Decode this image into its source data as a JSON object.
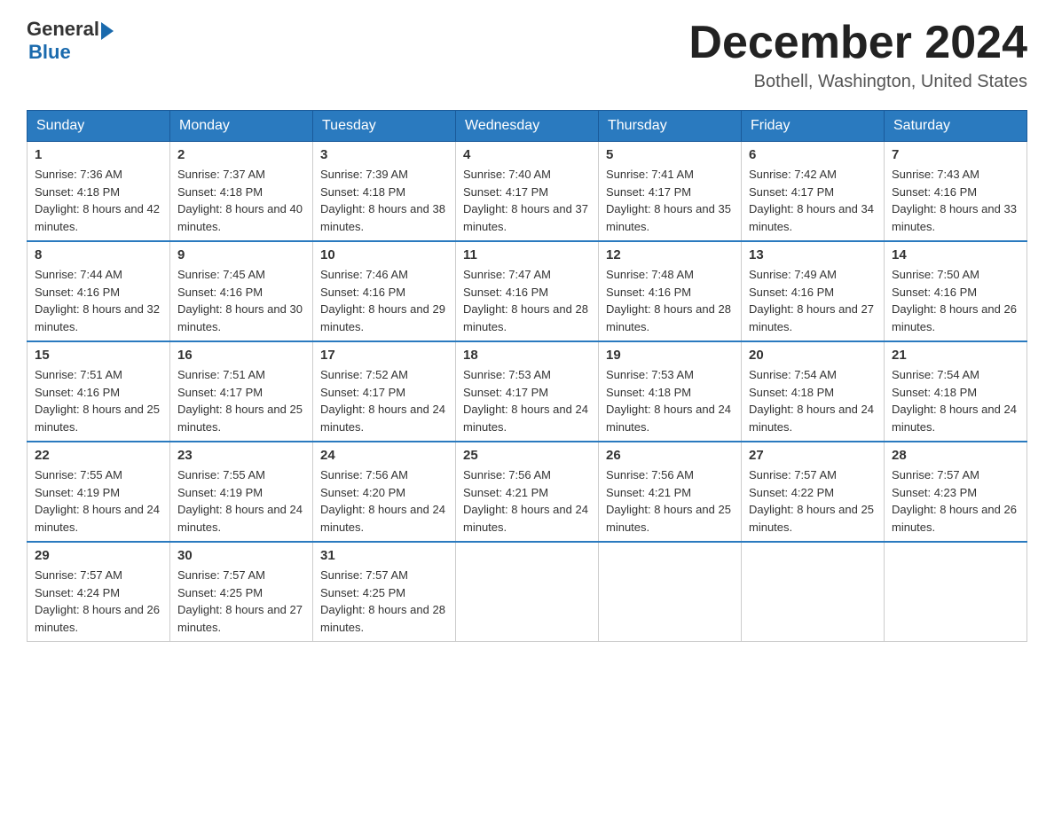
{
  "header": {
    "logo_general": "General",
    "logo_blue": "Blue",
    "month_year": "December 2024",
    "location": "Bothell, Washington, United States"
  },
  "days_of_week": [
    "Sunday",
    "Monday",
    "Tuesday",
    "Wednesday",
    "Thursday",
    "Friday",
    "Saturday"
  ],
  "weeks": [
    [
      {
        "day": "1",
        "sunrise": "7:36 AM",
        "sunset": "4:18 PM",
        "daylight": "8 hours and 42 minutes."
      },
      {
        "day": "2",
        "sunrise": "7:37 AM",
        "sunset": "4:18 PM",
        "daylight": "8 hours and 40 minutes."
      },
      {
        "day": "3",
        "sunrise": "7:39 AM",
        "sunset": "4:18 PM",
        "daylight": "8 hours and 38 minutes."
      },
      {
        "day": "4",
        "sunrise": "7:40 AM",
        "sunset": "4:17 PM",
        "daylight": "8 hours and 37 minutes."
      },
      {
        "day": "5",
        "sunrise": "7:41 AM",
        "sunset": "4:17 PM",
        "daylight": "8 hours and 35 minutes."
      },
      {
        "day": "6",
        "sunrise": "7:42 AM",
        "sunset": "4:17 PM",
        "daylight": "8 hours and 34 minutes."
      },
      {
        "day": "7",
        "sunrise": "7:43 AM",
        "sunset": "4:16 PM",
        "daylight": "8 hours and 33 minutes."
      }
    ],
    [
      {
        "day": "8",
        "sunrise": "7:44 AM",
        "sunset": "4:16 PM",
        "daylight": "8 hours and 32 minutes."
      },
      {
        "day": "9",
        "sunrise": "7:45 AM",
        "sunset": "4:16 PM",
        "daylight": "8 hours and 30 minutes."
      },
      {
        "day": "10",
        "sunrise": "7:46 AM",
        "sunset": "4:16 PM",
        "daylight": "8 hours and 29 minutes."
      },
      {
        "day": "11",
        "sunrise": "7:47 AM",
        "sunset": "4:16 PM",
        "daylight": "8 hours and 28 minutes."
      },
      {
        "day": "12",
        "sunrise": "7:48 AM",
        "sunset": "4:16 PM",
        "daylight": "8 hours and 28 minutes."
      },
      {
        "day": "13",
        "sunrise": "7:49 AM",
        "sunset": "4:16 PM",
        "daylight": "8 hours and 27 minutes."
      },
      {
        "day": "14",
        "sunrise": "7:50 AM",
        "sunset": "4:16 PM",
        "daylight": "8 hours and 26 minutes."
      }
    ],
    [
      {
        "day": "15",
        "sunrise": "7:51 AM",
        "sunset": "4:16 PM",
        "daylight": "8 hours and 25 minutes."
      },
      {
        "day": "16",
        "sunrise": "7:51 AM",
        "sunset": "4:17 PM",
        "daylight": "8 hours and 25 minutes."
      },
      {
        "day": "17",
        "sunrise": "7:52 AM",
        "sunset": "4:17 PM",
        "daylight": "8 hours and 24 minutes."
      },
      {
        "day": "18",
        "sunrise": "7:53 AM",
        "sunset": "4:17 PM",
        "daylight": "8 hours and 24 minutes."
      },
      {
        "day": "19",
        "sunrise": "7:53 AM",
        "sunset": "4:18 PM",
        "daylight": "8 hours and 24 minutes."
      },
      {
        "day": "20",
        "sunrise": "7:54 AM",
        "sunset": "4:18 PM",
        "daylight": "8 hours and 24 minutes."
      },
      {
        "day": "21",
        "sunrise": "7:54 AM",
        "sunset": "4:18 PM",
        "daylight": "8 hours and 24 minutes."
      }
    ],
    [
      {
        "day": "22",
        "sunrise": "7:55 AM",
        "sunset": "4:19 PM",
        "daylight": "8 hours and 24 minutes."
      },
      {
        "day": "23",
        "sunrise": "7:55 AM",
        "sunset": "4:19 PM",
        "daylight": "8 hours and 24 minutes."
      },
      {
        "day": "24",
        "sunrise": "7:56 AM",
        "sunset": "4:20 PM",
        "daylight": "8 hours and 24 minutes."
      },
      {
        "day": "25",
        "sunrise": "7:56 AM",
        "sunset": "4:21 PM",
        "daylight": "8 hours and 24 minutes."
      },
      {
        "day": "26",
        "sunrise": "7:56 AM",
        "sunset": "4:21 PM",
        "daylight": "8 hours and 25 minutes."
      },
      {
        "day": "27",
        "sunrise": "7:57 AM",
        "sunset": "4:22 PM",
        "daylight": "8 hours and 25 minutes."
      },
      {
        "day": "28",
        "sunrise": "7:57 AM",
        "sunset": "4:23 PM",
        "daylight": "8 hours and 26 minutes."
      }
    ],
    [
      {
        "day": "29",
        "sunrise": "7:57 AM",
        "sunset": "4:24 PM",
        "daylight": "8 hours and 26 minutes."
      },
      {
        "day": "30",
        "sunrise": "7:57 AM",
        "sunset": "4:25 PM",
        "daylight": "8 hours and 27 minutes."
      },
      {
        "day": "31",
        "sunrise": "7:57 AM",
        "sunset": "4:25 PM",
        "daylight": "8 hours and 28 minutes."
      },
      null,
      null,
      null,
      null
    ]
  ],
  "labels": {
    "sunrise": "Sunrise: ",
    "sunset": "Sunset: ",
    "daylight": "Daylight: "
  }
}
